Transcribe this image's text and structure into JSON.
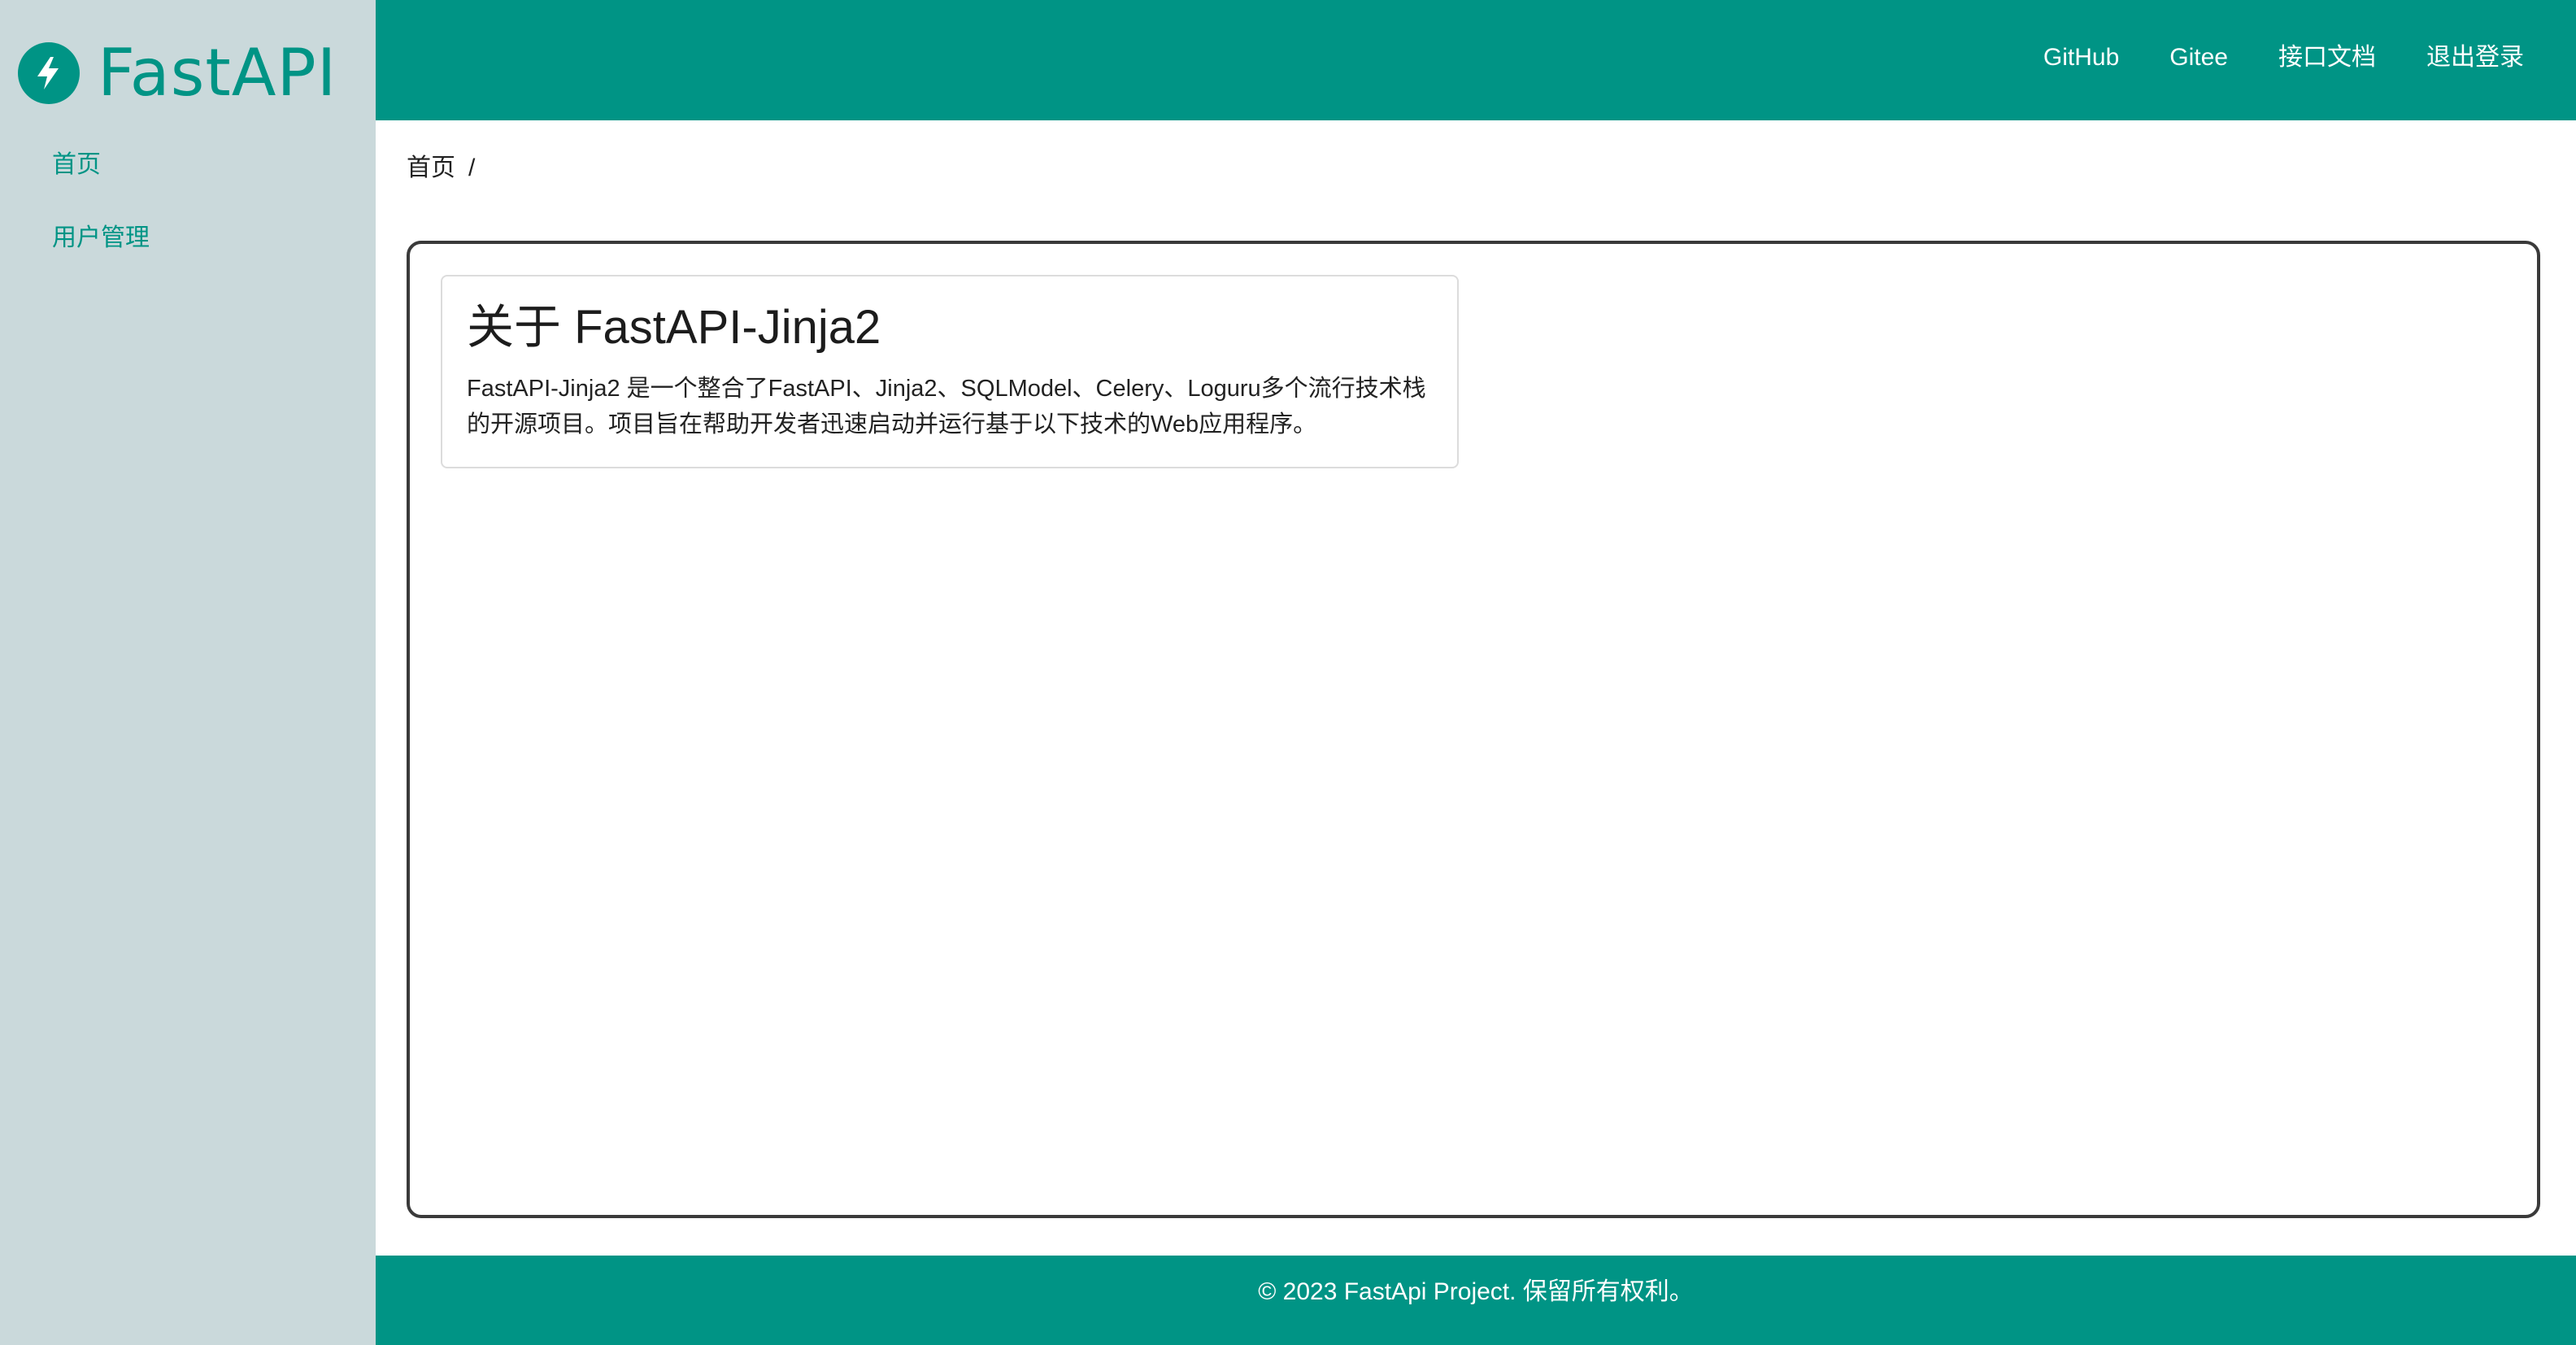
{
  "sidebar": {
    "logo_text": "FastAPI",
    "items": [
      {
        "label": "首页"
      },
      {
        "label": "用户管理"
      }
    ]
  },
  "header": {
    "links": [
      {
        "label": "GitHub"
      },
      {
        "label": "Gitee"
      },
      {
        "label": "接口文档"
      },
      {
        "label": "退出登录"
      }
    ]
  },
  "breadcrumb": {
    "current": "首页",
    "separator": "/"
  },
  "card": {
    "title": "关于 FastAPI-Jinja2",
    "description": "FastAPI-Jinja2 是一个整合了FastAPI、Jinja2、SQLModel、Celery、Loguru多个流行技术栈的开源项目。项目旨在帮助开发者迅速启动并运行基于以下技术的Web应用程序。"
  },
  "footer": {
    "text": "© 2023 FastApi Project. 保留所有权利。"
  },
  "colors": {
    "brand": "#009485",
    "sidebar_bg": "#cad9db"
  }
}
